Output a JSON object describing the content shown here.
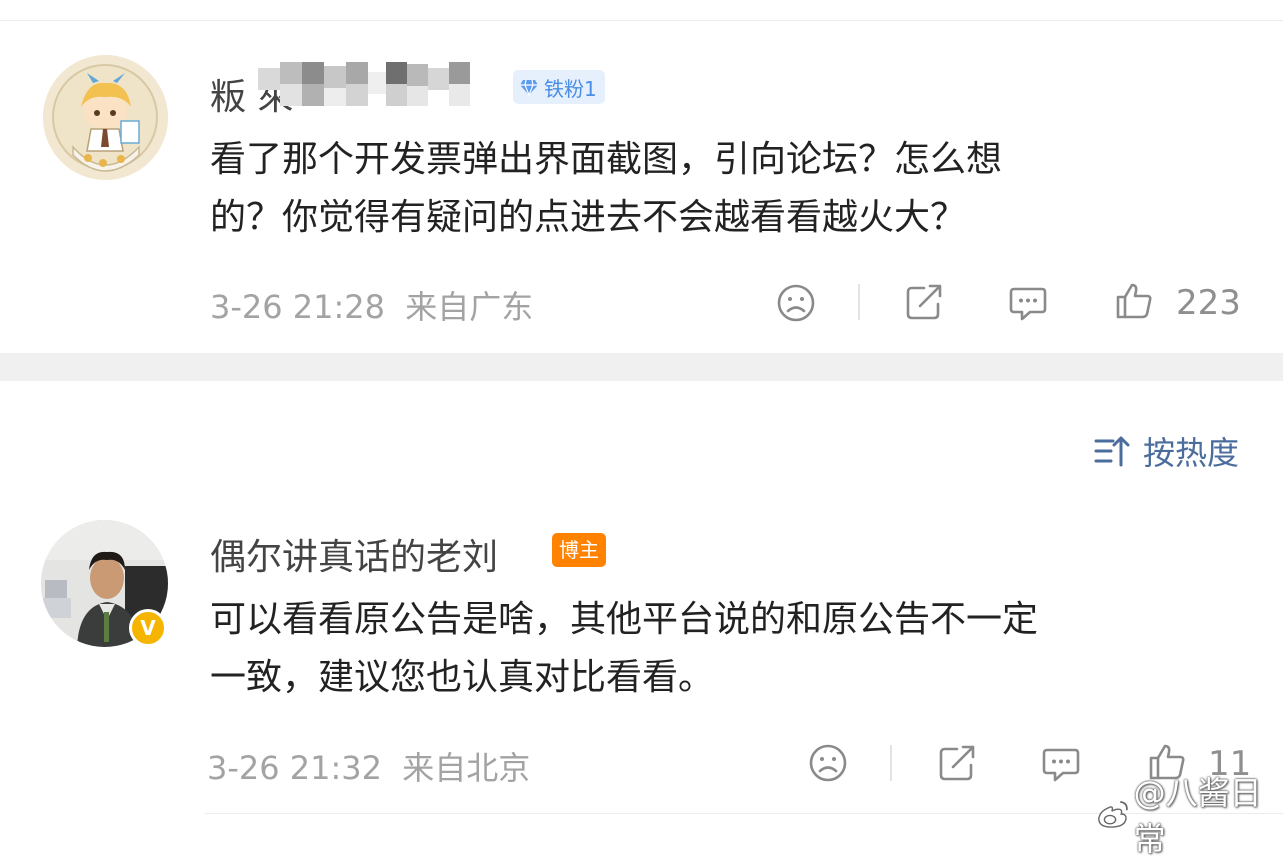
{
  "comments": [
    {
      "username_visible": "粄        來",
      "badge": "铁粉1",
      "text_line1": "看了那个开发票弹出界面截图，引向论坛？怎么想",
      "text_line2": "的？你觉得有疑问的点进去不会越看看越火大？",
      "timestamp": "3-26 21:28",
      "location": "来自广东",
      "likes": "223"
    },
    {
      "username": "偶尔讲真话的老刘",
      "badge": "博主",
      "verified_mark": "V",
      "text_line1": "可以看看原公告是啥，其他平台说的和原公告不一定",
      "text_line2": "一致，建议您也认真对比看看。",
      "timestamp": "3-26 21:32",
      "location": "来自北京",
      "likes": "11"
    }
  ],
  "sort": {
    "label": "按热度"
  },
  "watermark": {
    "text": "@八酱日常"
  },
  "colors": {
    "link_blue": "#4a6d9e",
    "blogger_orange": "#ff8200",
    "fan_badge_blue": "#4a8de6",
    "meta_gray": "#a3a3a3",
    "divider_gray": "#f0f0f0"
  },
  "icons": [
    "dislike-icon",
    "share-icon",
    "comment-icon",
    "like-icon",
    "sort-icon",
    "weibo-logo-icon",
    "gem-icon"
  ]
}
